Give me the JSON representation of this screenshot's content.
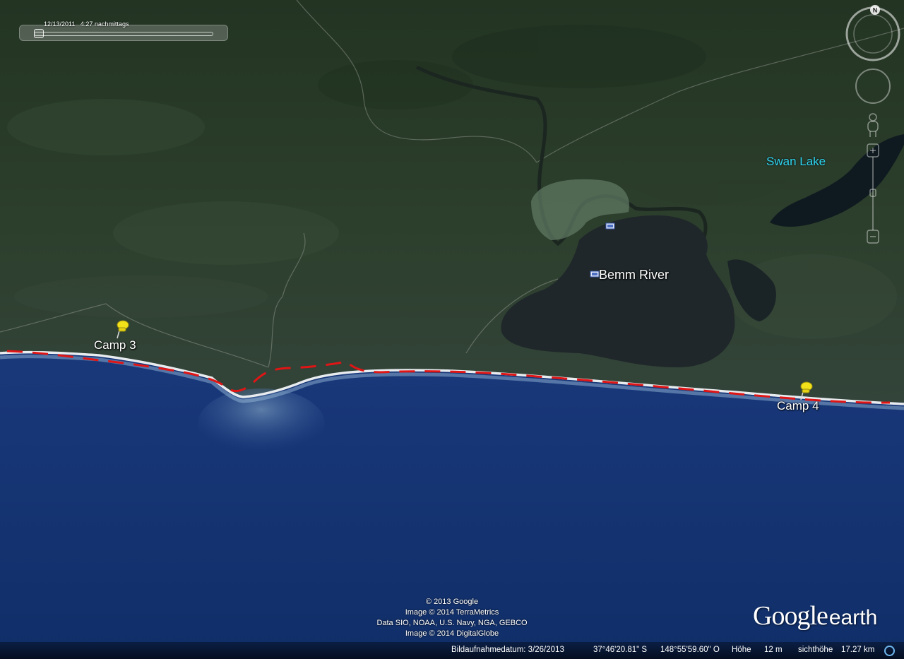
{
  "app": "Google Earth",
  "time_slider": {
    "date": "12/13/2011",
    "time": "4:27 nachmittags"
  },
  "places": {
    "camp3": {
      "name": "Camp 3",
      "icon": "yellow-pushpin-icon"
    },
    "camp4": {
      "name": "Camp 4",
      "icon": "yellow-pushpin-icon"
    },
    "bemm_river": {
      "name": "Bemm River",
      "icon": "town-flag-icon"
    },
    "swan_lake": {
      "name": "Swan Lake"
    }
  },
  "route": {
    "color": "#e01515",
    "style": "dashed"
  },
  "navigation": {
    "north_label": "N",
    "controls": [
      "compass-ring",
      "look-joystick",
      "street-view-pegman",
      "zoom-slider"
    ]
  },
  "attribution": [
    "© 2013 Google",
    "Image © 2014 TerraMetrics",
    "Data SIO, NOAA, U.S. Navy, NGA, GEBCO",
    "Image © 2014 DigitalGlobe"
  ],
  "logo": {
    "google": "Google",
    "earth": "earth"
  },
  "status_bar": {
    "imagery_date": "Bildaufnahmedatum: 3/26/2013",
    "lat": "37°46'20.81\" S",
    "lon": "148°55'59.60\" O",
    "elevation_label": "Höhe",
    "elevation_value": "12 m",
    "eye_alt_label": "sichthöhe",
    "eye_alt_value": "17.27 km"
  },
  "colors": {
    "land": "#2c3d2c",
    "sea": "#1e3c7e",
    "water_label": "#2fd8ee",
    "pin": "#f2e21a"
  }
}
